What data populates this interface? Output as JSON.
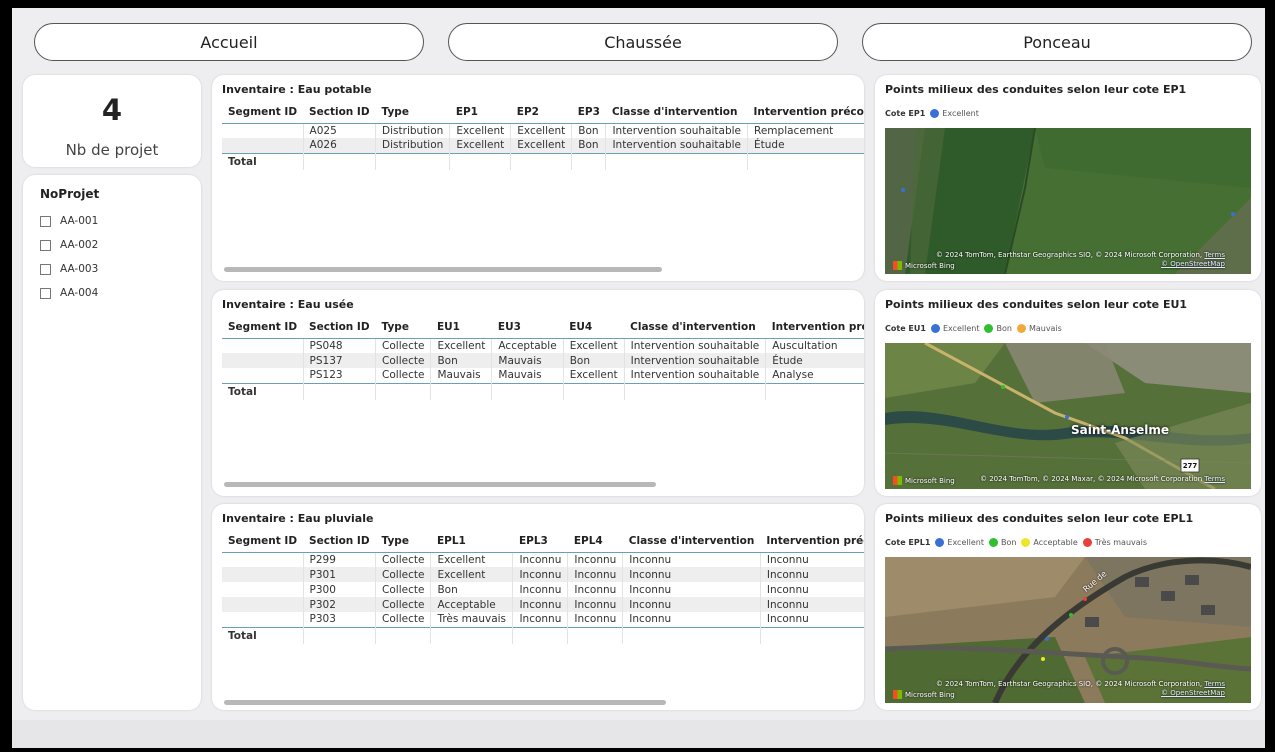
{
  "nav": {
    "accueil": "Accueil",
    "chaussee": "Chaussée",
    "ponceau": "Ponceau"
  },
  "kpi": {
    "value": "4",
    "label": "Nb de projet"
  },
  "slicer": {
    "title": "NoProjet",
    "items": [
      "AA-001",
      "AA-002",
      "AA-003",
      "AA-004"
    ]
  },
  "tables": {
    "ep": {
      "title": "Inventaire : Eau potable",
      "headers": [
        "Segment ID",
        "Section ID",
        "Type",
        "EP1",
        "EP2",
        "EP3",
        "Classe d'intervention",
        "Intervention préconisée"
      ],
      "rows": [
        [
          "",
          "A025",
          "Distribution",
          "Excellent",
          "Excellent",
          "Bon",
          "Intervention souhaitable",
          "Remplacement"
        ],
        [
          "",
          "A026",
          "Distribution",
          "Excellent",
          "Excellent",
          "Bon",
          "Intervention souhaitable",
          "Étude"
        ]
      ],
      "total": "Total"
    },
    "eu": {
      "title": "Inventaire : Eau usée",
      "headers": [
        "Segment ID",
        "Section ID",
        "Type",
        "EU1",
        "EU3",
        "EU4",
        "Classe d'intervention",
        "Intervention préconi"
      ],
      "rows": [
        [
          "",
          "PS048",
          "Collecte",
          "Excellent",
          "Acceptable",
          "Excellent",
          "Intervention souhaitable",
          "Auscultation"
        ],
        [
          "",
          "PS137",
          "Collecte",
          "Bon",
          "Mauvais",
          "Bon",
          "Intervention souhaitable",
          "Étude"
        ],
        [
          "",
          "PS123",
          "Collecte",
          "Mauvais",
          "Mauvais",
          "Excellent",
          "Intervention souhaitable",
          "Analyse"
        ]
      ],
      "total": "Total"
    },
    "epl": {
      "title": "Inventaire : Eau pluviale",
      "headers": [
        "Segment ID",
        "Section ID",
        "Type",
        "EPL1",
        "EPL3",
        "EPL4",
        "Classe d'intervention",
        "Intervention préconisée"
      ],
      "rows": [
        [
          "",
          "P299",
          "Collecte",
          "Excellent",
          "Inconnu",
          "Inconnu",
          "Inconnu",
          "Inconnu"
        ],
        [
          "",
          "P301",
          "Collecte",
          "Excellent",
          "Inconnu",
          "Inconnu",
          "Inconnu",
          "Inconnu"
        ],
        [
          "",
          "P300",
          "Collecte",
          "Bon",
          "Inconnu",
          "Inconnu",
          "Inconnu",
          "Inconnu"
        ],
        [
          "",
          "P302",
          "Collecte",
          "Acceptable",
          "Inconnu",
          "Inconnu",
          "Inconnu",
          "Inconnu"
        ],
        [
          "",
          "P303",
          "Collecte",
          "Très mauvais",
          "Inconnu",
          "Inconnu",
          "Inconnu",
          "Inconnu"
        ]
      ],
      "total": "Total"
    }
  },
  "maps": {
    "ep": {
      "title": "Points milieux des conduites selon leur cote EP1",
      "legend_title": "Cote EP1",
      "legend": [
        {
          "label": "Excellent",
          "color": "#3a6fd8"
        }
      ],
      "attribution": "© 2024 TomTom, Earthstar Geographics SIO, © 2024 Microsoft Corporation,",
      "terms": "Terms",
      "osm": "© OpenStreetMap",
      "bing": "Microsoft Bing"
    },
    "eu": {
      "title": "Points milieux des conduites selon leur cote EU1",
      "legend_title": "Cote EU1",
      "legend": [
        {
          "label": "Excellent",
          "color": "#3a6fd8"
        },
        {
          "label": "Bon",
          "color": "#2fbf2f"
        },
        {
          "label": "Mauvais",
          "color": "#f2a93b"
        }
      ],
      "place": "Saint-Anselme",
      "road": "277",
      "attribution": "© 2024 TomTom, © 2024 Maxar, © 2024 Microsoft Corporation",
      "terms": "Terms",
      "bing": "Microsoft Bing"
    },
    "epl": {
      "title": "Points milieux des conduites selon leur cote EPL1",
      "legend_title": "Cote EPL1",
      "legend": [
        {
          "label": "Excellent",
          "color": "#3a6fd8"
        },
        {
          "label": "Bon",
          "color": "#2fbf2f"
        },
        {
          "label": "Acceptable",
          "color": "#ece52a"
        },
        {
          "label": "Très mauvais",
          "color": "#e8413a"
        }
      ],
      "street": "Rue de",
      "attribution": "© 2024 TomTom, Earthstar Geographics SIO, © 2024 Microsoft Corporation,",
      "terms": "Terms",
      "osm": "© OpenStreetMap",
      "bing": "Microsoft Bing"
    }
  }
}
